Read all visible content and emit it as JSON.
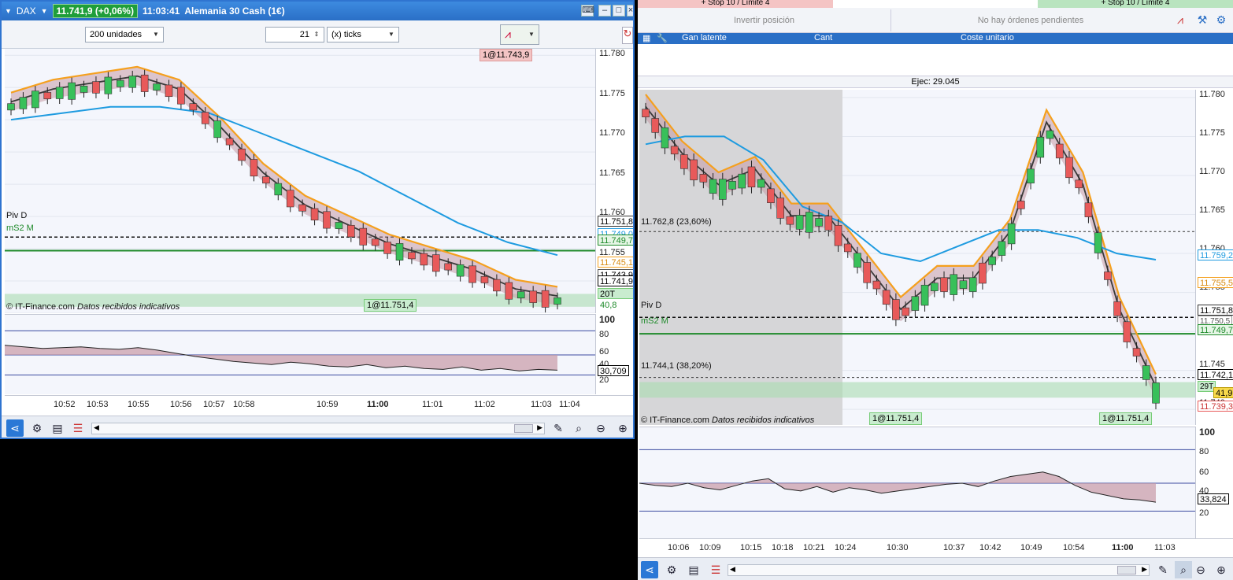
{
  "left": {
    "symbol": "DAX",
    "price_badge": "11.741,9 (+0,06%)",
    "time": "11:03:41",
    "instrument": "Alemania 30 Cash (1€)",
    "units_select": "200 unidades",
    "ticks_value": "21",
    "ticks_unit": "(x) ticks",
    "order_tag_top": "1@11.743,9",
    "order_tag_bottom": "1@11.751,4",
    "piv_label": "Piv D",
    "ms2_label": "mS2 M",
    "copyright": "© IT-Finance.com",
    "data_note": "Datos recibidos indicativos",
    "y_labels": [
      "11.780",
      "11.775",
      "11.770",
      "11.765",
      "11.760",
      "11.755",
      "11.750",
      "11.745",
      "11.740"
    ],
    "y_tags": {
      "piv": "11.751,8",
      "ms2": "11.749,7",
      "ma_blue": "11.749,0",
      "ma_orange": "11.745,1",
      "ma_dark": "11.743,9",
      "last": "11.741,9",
      "ticks": "20T",
      "ticks_val": "40,8"
    },
    "osc_labels": [
      "100",
      "80",
      "60",
      "40",
      "30,709",
      "20"
    ],
    "x_labels": [
      "10:52",
      "10:53",
      "10:55",
      "10:56",
      "10:57",
      "10:58",
      "10:59",
      "11:00",
      "11:01",
      "11:02",
      "11:03",
      "11:04"
    ]
  },
  "right": {
    "top_strip_left": "+ Stop 10 / Límite 4",
    "top_strip_right": "+ Stop 10 / Límite 4",
    "invert_label": "Invertir posición",
    "no_orders": "No hay órdenes pendientes",
    "col_gan": "Gan latente",
    "col_cant": "Cant",
    "col_coste": "Coste unitario",
    "ejec": "Ejec:  29.045",
    "fib_236": "11.762,8 (23,60%)",
    "fib_382": "11.744,1 (38,20%)",
    "piv_label": "Piv D",
    "ms2_label": "mS2 M",
    "copyright": "© IT-Finance.com",
    "data_note": "Datos recibidos indicativos",
    "order_tag_a": "1@11.751,4",
    "order_tag_b": "1@11.751,4",
    "y_labels": [
      "11.780",
      "11.775",
      "11.770",
      "11.765",
      "11.760",
      "11.755",
      "11.750",
      "11.745",
      "11.740"
    ],
    "y_tags": {
      "ma_blue": "11.759,2",
      "ma_orange": "11.755,5",
      "piv": "11.751,8",
      "ms2b": "11.750,5",
      "ms2": "11.749,7",
      "last": "11.742,1",
      "ticks": "29T",
      "ticks_val": "41,9",
      "low": "11.739,3"
    },
    "osc_labels": [
      "100",
      "80",
      "60",
      "40",
      "33,824",
      "20"
    ],
    "x_labels": [
      "10:06",
      "10:09",
      "10:15",
      "10:18",
      "10:21",
      "10:24",
      "10:30",
      "10:37",
      "10:42",
      "10:49",
      "10:54",
      "11:00",
      "11:03"
    ]
  },
  "colors": {
    "up": "#38c05a",
    "down": "#e85a5a",
    "orange": "#f5a01e",
    "blue": "#1e9be0",
    "green_line": "#1e8a2a",
    "cloud_green": "#7fc08c",
    "cloud_red": "#c79aa6",
    "title": "#2a6fc6"
  },
  "chart_data": [
    {
      "type": "line",
      "title": "",
      "x": [
        "10:52",
        "10:53",
        "10:55",
        "10:56",
        "10:57",
        "10:58",
        "10:59",
        "11:00",
        "11:01",
        "11:02",
        "11:03"
      ],
      "series": [
        {
          "values": [
            11772,
            11774,
            11775,
            11776,
            11774,
            11768,
            11761,
            11756,
            11753,
            11750,
            11748,
            11746,
            11743,
            11741.9
          ]
        },
        {
          "values": [
            11770,
            11771,
            11772,
            11772,
            11771,
            11768,
            11765,
            11762,
            11758,
            11754,
            11751,
            11749
          ]
        }
      ],
      "ylim": [
        11740,
        11781
      ]
    },
    {
      "type": "line",
      "title": "",
      "x": [
        "10:06",
        "10:09",
        "10:15",
        "10:18",
        "10:21",
        "10:24",
        "10:30",
        "10:37",
        "10:42",
        "10:49",
        "10:54",
        "11:00",
        "11:03"
      ],
      "series": [
        {
          "values": [
            11778,
            11772,
            11768,
            11770,
            11764,
            11764,
            11758,
            11752,
            11756,
            11756,
            11762,
            11776,
            11768,
            11752,
            11742.1
          ]
        },
        {
          "values": [
            11774,
            11775,
            11775,
            11772,
            11766,
            11764,
            11760,
            11759,
            11761,
            11763,
            11763,
            11762,
            11760,
            11759.2
          ]
        }
      ],
      "ylim": [
        11738,
        11781
      ]
    }
  ]
}
